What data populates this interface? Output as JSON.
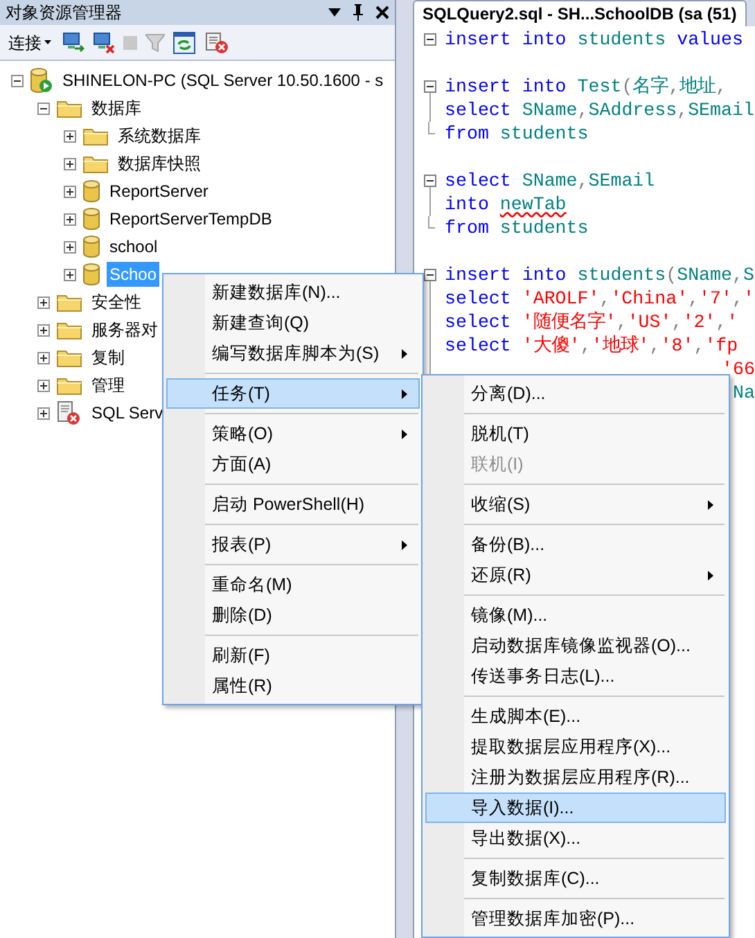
{
  "explorer": {
    "title": "对象资源管理器",
    "toolbar": {
      "connect": "连接"
    },
    "tree": [
      {
        "kind": "server",
        "label": "SHINELON-PC (SQL Server 10.50.1600 - s",
        "expanded": true,
        "selected": false,
        "children": [
          {
            "kind": "folder",
            "label": "数据库",
            "expanded": true,
            "selected": false,
            "children": [
              {
                "kind": "folder",
                "label": "系统数据库",
                "expanded": false,
                "selected": false
              },
              {
                "kind": "folder",
                "label": "数据库快照",
                "expanded": false,
                "selected": false
              },
              {
                "kind": "database",
                "label": "ReportServer",
                "expanded": false,
                "selected": false
              },
              {
                "kind": "database",
                "label": "ReportServerTempDB",
                "expanded": false,
                "selected": false
              },
              {
                "kind": "database",
                "label": "school",
                "expanded": false,
                "selected": false
              },
              {
                "kind": "database",
                "label": "Schoo",
                "expanded": false,
                "selected": true
              }
            ]
          },
          {
            "kind": "folder",
            "label": "安全性",
            "expanded": false,
            "selected": false
          },
          {
            "kind": "folder",
            "label": "服务器对",
            "expanded": false,
            "selected": false
          },
          {
            "kind": "folder",
            "label": "复制",
            "expanded": false,
            "selected": false
          },
          {
            "kind": "folder",
            "label": "管理",
            "expanded": false,
            "selected": false
          },
          {
            "kind": "agent",
            "label": "SQL Serv",
            "expanded": false,
            "selected": false
          }
        ]
      }
    ]
  },
  "editor": {
    "tab": "SQLQuery2.sql - SH...SchoolDB (sa (51)",
    "lines": [
      {
        "kind": "fold-single",
        "segments": [
          {
            "kind": "keyword",
            "text": "insert into "
          },
          {
            "kind": "ident",
            "text": "students "
          },
          {
            "kind": "keyword",
            "text": "values"
          }
        ]
      },
      {
        "kind": "blank"
      },
      {
        "kind": "fold-start",
        "segments": [
          {
            "kind": "keyword",
            "text": "insert into "
          },
          {
            "kind": "ident",
            "text": "Test"
          },
          {
            "kind": "punct",
            "text": "("
          },
          {
            "kind": "ident",
            "text": "名字"
          },
          {
            "kind": "punct",
            "text": ","
          },
          {
            "kind": "ident",
            "text": "地址"
          },
          {
            "kind": "punct",
            "text": ","
          }
        ]
      },
      {
        "kind": "fold-inner",
        "segments": [
          {
            "kind": "keyword",
            "text": "select "
          },
          {
            "kind": "ident",
            "text": "SName"
          },
          {
            "kind": "punct",
            "text": ","
          },
          {
            "kind": "ident",
            "text": "SAddress"
          },
          {
            "kind": "punct",
            "text": ","
          },
          {
            "kind": "ident",
            "text": "SEmail"
          }
        ]
      },
      {
        "kind": "fold-end",
        "segments": [
          {
            "kind": "keyword",
            "text": "from "
          },
          {
            "kind": "ident",
            "text": "students"
          }
        ]
      },
      {
        "kind": "blank"
      },
      {
        "kind": "fold-start",
        "segments": [
          {
            "kind": "keyword",
            "text": "select "
          },
          {
            "kind": "ident",
            "text": "SName"
          },
          {
            "kind": "punct",
            "text": ","
          },
          {
            "kind": "ident",
            "text": "SEmail"
          }
        ]
      },
      {
        "kind": "fold-inner",
        "segments": [
          {
            "kind": "keyword",
            "text": "into "
          },
          {
            "kind": "ident",
            "text": "newTab",
            "error": true
          }
        ]
      },
      {
        "kind": "fold-end",
        "segments": [
          {
            "kind": "keyword",
            "text": "from "
          },
          {
            "kind": "ident",
            "text": "students"
          }
        ]
      },
      {
        "kind": "blank"
      },
      {
        "kind": "fold-start",
        "segments": [
          {
            "kind": "keyword",
            "text": "insert into "
          },
          {
            "kind": "ident",
            "text": "students"
          },
          {
            "kind": "punct",
            "text": "("
          },
          {
            "kind": "ident",
            "text": "SName"
          },
          {
            "kind": "punct",
            "text": ","
          },
          {
            "kind": "ident",
            "text": "S"
          }
        ]
      },
      {
        "kind": "fold-inner",
        "segments": [
          {
            "kind": "keyword",
            "text": "select "
          },
          {
            "kind": "string",
            "text": "'AROLF'"
          },
          {
            "kind": "punct",
            "text": ","
          },
          {
            "kind": "string",
            "text": "'China'"
          },
          {
            "kind": "punct",
            "text": ","
          },
          {
            "kind": "string",
            "text": "'7'"
          },
          {
            "kind": "punct",
            "text": ","
          },
          {
            "kind": "string",
            "text": "'"
          }
        ]
      },
      {
        "kind": "fold-inner",
        "segments": [
          {
            "kind": "keyword",
            "text": "select "
          },
          {
            "kind": "string",
            "text": "'随便名字'"
          },
          {
            "kind": "punct",
            "text": ","
          },
          {
            "kind": "string",
            "text": "'US'"
          },
          {
            "kind": "punct",
            "text": ","
          },
          {
            "kind": "string",
            "text": "'2'"
          },
          {
            "kind": "punct",
            "text": ","
          },
          {
            "kind": "string",
            "text": "'"
          }
        ]
      },
      {
        "kind": "fold-inner",
        "changed": true,
        "segments": [
          {
            "kind": "keyword",
            "text": "select "
          },
          {
            "kind": "string",
            "text": "'大傻'"
          },
          {
            "kind": "punct",
            "text": ","
          },
          {
            "kind": "string",
            "text": "'地球'"
          },
          {
            "kind": "punct",
            "text": ","
          },
          {
            "kind": "string",
            "text": "'8'"
          },
          {
            "kind": "punct",
            "text": ","
          },
          {
            "kind": "string",
            "text": "'fp"
          }
        ]
      },
      {
        "kind": "fold-inner",
        "changed": true,
        "clipped": true,
        "segments": [
          {
            "kind": "string",
            "text": "'66"
          }
        ]
      },
      {
        "kind": "fold-inner",
        "changed": true,
        "clipped": true,
        "segments": [
          {
            "kind": "ident",
            "text": "Na"
          }
        ]
      }
    ]
  },
  "context_menu": [
    {
      "kind": "item",
      "label": "新建数据库(N)...",
      "submenu": false,
      "selected": false
    },
    {
      "kind": "item",
      "label": "新建查询(Q)",
      "submenu": false,
      "selected": false
    },
    {
      "kind": "item",
      "label": "编写数据库脚本为(S)",
      "submenu": true,
      "selected": false
    },
    {
      "kind": "separator"
    },
    {
      "kind": "item",
      "label": "任务(T)",
      "submenu": true,
      "selected": true
    },
    {
      "kind": "separator"
    },
    {
      "kind": "item",
      "label": "策略(O)",
      "submenu": true,
      "selected": false
    },
    {
      "kind": "item",
      "label": "方面(A)",
      "submenu": false,
      "selected": false
    },
    {
      "kind": "separator"
    },
    {
      "kind": "item",
      "label": "启动 PowerShell(H)",
      "submenu": false,
      "selected": false
    },
    {
      "kind": "separator"
    },
    {
      "kind": "item",
      "label": "报表(P)",
      "submenu": true,
      "selected": false
    },
    {
      "kind": "separator"
    },
    {
      "kind": "item",
      "label": "重命名(M)",
      "submenu": false,
      "selected": false
    },
    {
      "kind": "item",
      "label": "删除(D)",
      "submenu": false,
      "selected": false
    },
    {
      "kind": "separator"
    },
    {
      "kind": "item",
      "label": "刷新(F)",
      "submenu": false,
      "selected": false
    },
    {
      "kind": "item",
      "label": "属性(R)",
      "submenu": false,
      "selected": false
    }
  ],
  "tasks_menu": [
    {
      "kind": "item",
      "label": "分离(D)...",
      "submenu": false,
      "selected": false,
      "disabled": false
    },
    {
      "kind": "separator"
    },
    {
      "kind": "item",
      "label": "脱机(T)",
      "submenu": false,
      "selected": false,
      "disabled": false
    },
    {
      "kind": "item",
      "label": "联机(I)",
      "submenu": false,
      "selected": false,
      "disabled": true
    },
    {
      "kind": "separator"
    },
    {
      "kind": "item",
      "label": "收缩(S)",
      "submenu": true,
      "selected": false,
      "disabled": false
    },
    {
      "kind": "separator"
    },
    {
      "kind": "item",
      "label": "备份(B)...",
      "submenu": false,
      "selected": false,
      "disabled": false
    },
    {
      "kind": "item",
      "label": "还原(R)",
      "submenu": true,
      "selected": false,
      "disabled": false
    },
    {
      "kind": "separator"
    },
    {
      "kind": "item",
      "label": "镜像(M)...",
      "submenu": false,
      "selected": false,
      "disabled": false
    },
    {
      "kind": "item",
      "label": "启动数据库镜像监视器(O)...",
      "submenu": false,
      "selected": false,
      "disabled": false
    },
    {
      "kind": "item",
      "label": "传送事务日志(L)...",
      "submenu": false,
      "selected": false,
      "disabled": false
    },
    {
      "kind": "separator"
    },
    {
      "kind": "item",
      "label": "生成脚本(E)...",
      "submenu": false,
      "selected": false,
      "disabled": false
    },
    {
      "kind": "item",
      "label": "提取数据层应用程序(X)...",
      "submenu": false,
      "selected": false,
      "disabled": false
    },
    {
      "kind": "item",
      "label": "注册为数据层应用程序(R)...",
      "submenu": false,
      "selected": false,
      "disabled": false
    },
    {
      "kind": "item",
      "label": "导入数据(I)...",
      "submenu": false,
      "selected": true,
      "disabled": false
    },
    {
      "kind": "item",
      "label": "导出数据(X)...",
      "submenu": false,
      "selected": false,
      "disabled": false
    },
    {
      "kind": "separator"
    },
    {
      "kind": "item",
      "label": "复制数据库(C)...",
      "submenu": false,
      "selected": false,
      "disabled": false
    },
    {
      "kind": "separator"
    },
    {
      "kind": "item",
      "label": "管理数据库加密(P)...",
      "submenu": false,
      "selected": false,
      "disabled": false
    }
  ]
}
